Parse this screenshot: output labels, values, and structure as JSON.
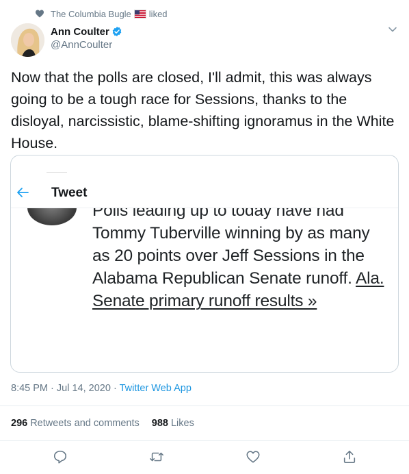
{
  "social_context": {
    "name": "The Columbia Bugle",
    "flag": "us-flag-emoji",
    "action": "liked"
  },
  "author": {
    "name": "Ann Coulter",
    "handle": "@AnnCoulter",
    "verified": true
  },
  "tweet": {
    "text": "Now that the polls are closed, I'll admit, this was always going to be a tough race for Sessions, thanks to the disloyal, narcissistic, blame-shifting ignoramus in the White House."
  },
  "embedded_card": {
    "header_title": "Tweet",
    "body_text": "Polls leading up to today have had Tommy Tuberville winning by as many as 20 points over Jeff Sessions in the Alabama Republican Senate runoff.",
    "link_text": "Ala. Senate primary runoff results »"
  },
  "meta": {
    "time": "8:45 PM",
    "separator": "·",
    "date": "Jul 14, 2020",
    "source": "Twitter Web App"
  },
  "stats": {
    "retweets_count": "296",
    "retweets_label": "Retweets and comments",
    "likes_count": "988",
    "likes_label": "Likes"
  },
  "icons": {
    "context": "heart-icon",
    "verified": "verified-badge-icon",
    "menu": "chevron-down-icon",
    "back": "back-arrow-icon",
    "reply": "reply-icon",
    "retweet": "retweet-icon",
    "like": "like-icon",
    "share": "share-icon"
  },
  "colors": {
    "accent": "#1da1f2",
    "link": "#1b95e0",
    "secondary_text": "#657786",
    "border": "#ccd6dd"
  }
}
